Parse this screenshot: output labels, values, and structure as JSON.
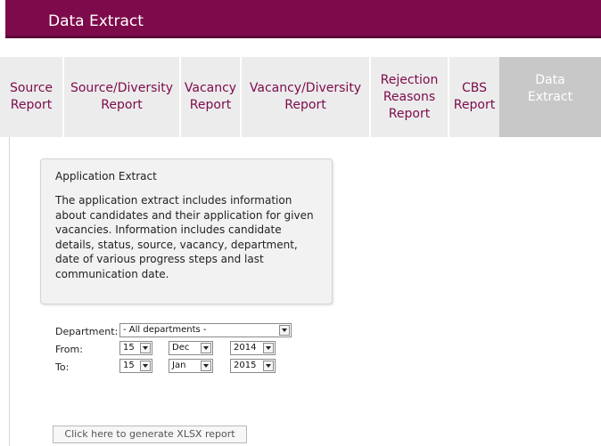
{
  "header": {
    "title": "Data Extract"
  },
  "tabs": [
    {
      "label": [
        "Source",
        "Report"
      ],
      "active": false
    },
    {
      "label": [
        "Source/Diversity",
        "Report"
      ],
      "active": false
    },
    {
      "label": [
        "Vacancy",
        "Report"
      ],
      "active": false
    },
    {
      "label": [
        "Vacancy/Diversity",
        "Report"
      ],
      "active": false
    },
    {
      "label": [
        "Rejection",
        "Reasons",
        "Report"
      ],
      "active": false
    },
    {
      "label": [
        "CBS",
        "Report"
      ],
      "active": false
    },
    {
      "label": [
        "Data",
        "Extract"
      ],
      "active": true
    }
  ],
  "card": {
    "title": "Application Extract",
    "body": "The application extract includes information about candidates and their application for given vacancies.  Information includes candidate details, status, source, vacancy, department, date of various progress steps and last communication date."
  },
  "form": {
    "department_label": "Department:",
    "department_value": "- All departments -",
    "from_label": "From:",
    "from_day": "15",
    "from_month": "Dec",
    "from_year": "2014",
    "to_label": "To:",
    "to_day": "15",
    "to_month": "Jan",
    "to_year": "2015"
  },
  "actions": {
    "generate_label": "Click here to generate XLSX report"
  },
  "colors": {
    "brand": "#7d0b4b",
    "tab_bg": "#ececec",
    "tab_active_bg": "#c8c8c8"
  }
}
